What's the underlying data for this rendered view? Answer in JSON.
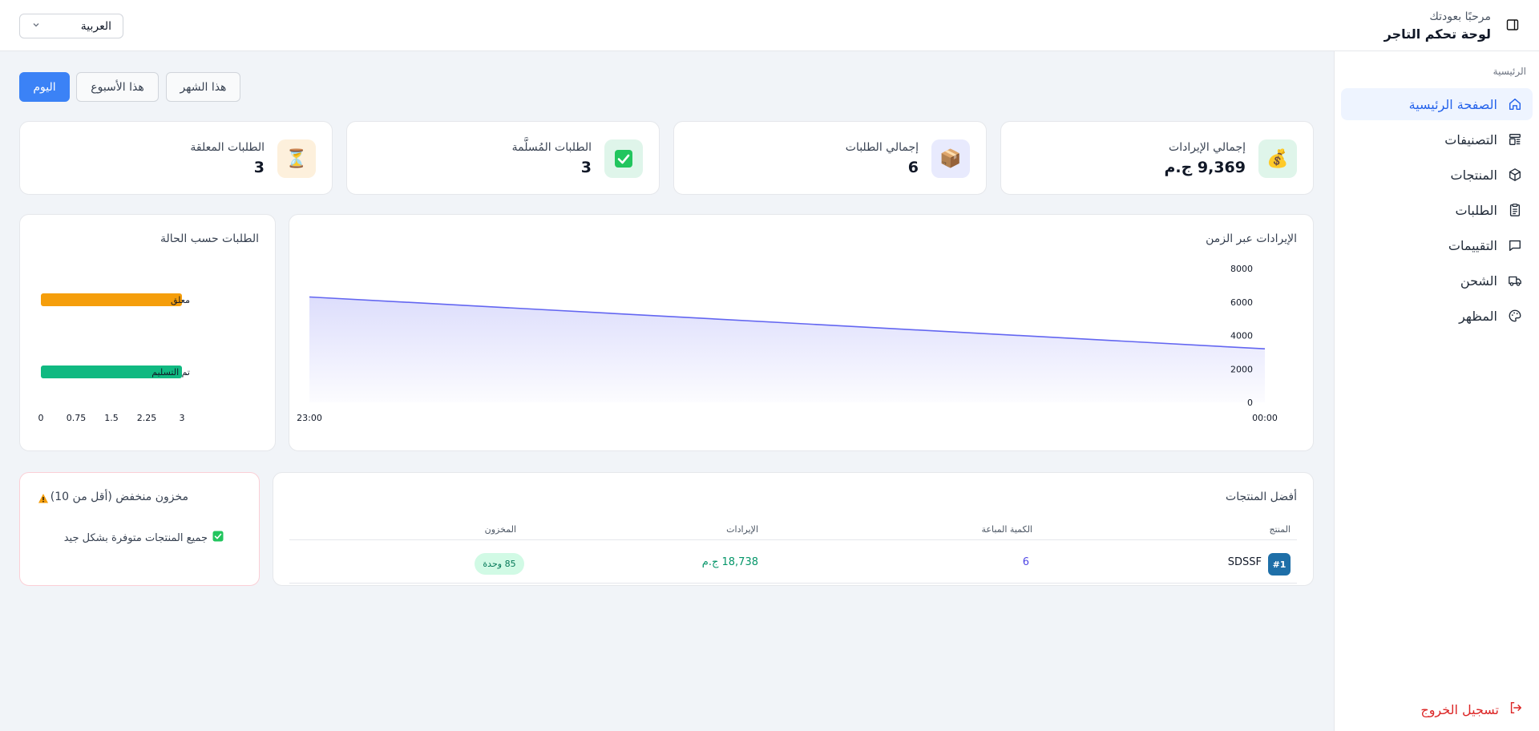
{
  "header": {
    "welcome": "مرحبًا بعودتك",
    "title": "لوحة تحكم التاجر",
    "language": "العربية"
  },
  "sidebar": {
    "section_label": "الرئيسية",
    "items": [
      {
        "label": "الصفحة الرئيسية",
        "icon": "home-icon",
        "active": true
      },
      {
        "label": "التصنيفات",
        "icon": "categories-icon",
        "active": false
      },
      {
        "label": "المنتجات",
        "icon": "box-icon",
        "active": false
      },
      {
        "label": "الطلبات",
        "icon": "clipboard-icon",
        "active": false
      },
      {
        "label": "التقييمات",
        "icon": "message-icon",
        "active": false
      },
      {
        "label": "الشحن",
        "icon": "truck-icon",
        "active": false
      },
      {
        "label": "المظهر",
        "icon": "palette-icon",
        "active": false
      }
    ],
    "logout": "تسجيل الخروج"
  },
  "period_tabs": {
    "today": "اليوم",
    "week": "هذا الأسبوع",
    "month": "هذا الشهر",
    "active": "today"
  },
  "stats": [
    {
      "label": "إجمالي الإيرادات",
      "value": "9,369 ج.م",
      "icon": "money-bag-icon"
    },
    {
      "label": "إجمالي الطلبات",
      "value": "6",
      "icon": "package-icon"
    },
    {
      "label": "الطلبات المُسلَّمة",
      "value": "3",
      "icon": "check-icon"
    },
    {
      "label": "الطلبات المعلقة",
      "value": "3",
      "icon": "hourglass-icon"
    }
  ],
  "revenue_chart": {
    "title": "الإيرادات عبر الزمن"
  },
  "status_chart": {
    "title": "الطلبات حسب الحالة"
  },
  "chart_data": [
    {
      "type": "area",
      "title": "الإيرادات عبر الزمن",
      "x": [
        "00:00",
        "23:00"
      ],
      "y": [
        3200,
        6300
      ],
      "ylim": [
        0,
        8000
      ],
      "yticks": [
        "0",
        "2000",
        "4000",
        "6000",
        "8000"
      ],
      "color": "#6366f1"
    },
    {
      "type": "bar",
      "title": "الطلبات حسب الحالة",
      "categories": [
        "معلق",
        "تم التسليم"
      ],
      "values": [
        3,
        3
      ],
      "colors": [
        "#f59e0b",
        "#10b981"
      ],
      "xlim": [
        0,
        3
      ],
      "xticks": [
        "0",
        "0.75",
        "1.5",
        "2.25",
        "3"
      ]
    }
  ],
  "top_products": {
    "title": "أفضل المنتجات",
    "columns": [
      "المنتج",
      "الكمية المباعة",
      "الإيرادات",
      "المخزون"
    ],
    "rows": [
      {
        "rank": "#1",
        "name": "SDSSF",
        "qty": "6",
        "revenue": "18,738 ج.م",
        "stock": "85 وحدة"
      }
    ]
  },
  "low_stock": {
    "title": "مخزون منخفض (أقل من 10)",
    "message": "جميع المنتجات متوفرة بشكل جيد"
  },
  "colors": {
    "accent": "#2563eb",
    "button": "#3b82f6",
    "danger": "#dc2626",
    "line": "#6366f1"
  }
}
